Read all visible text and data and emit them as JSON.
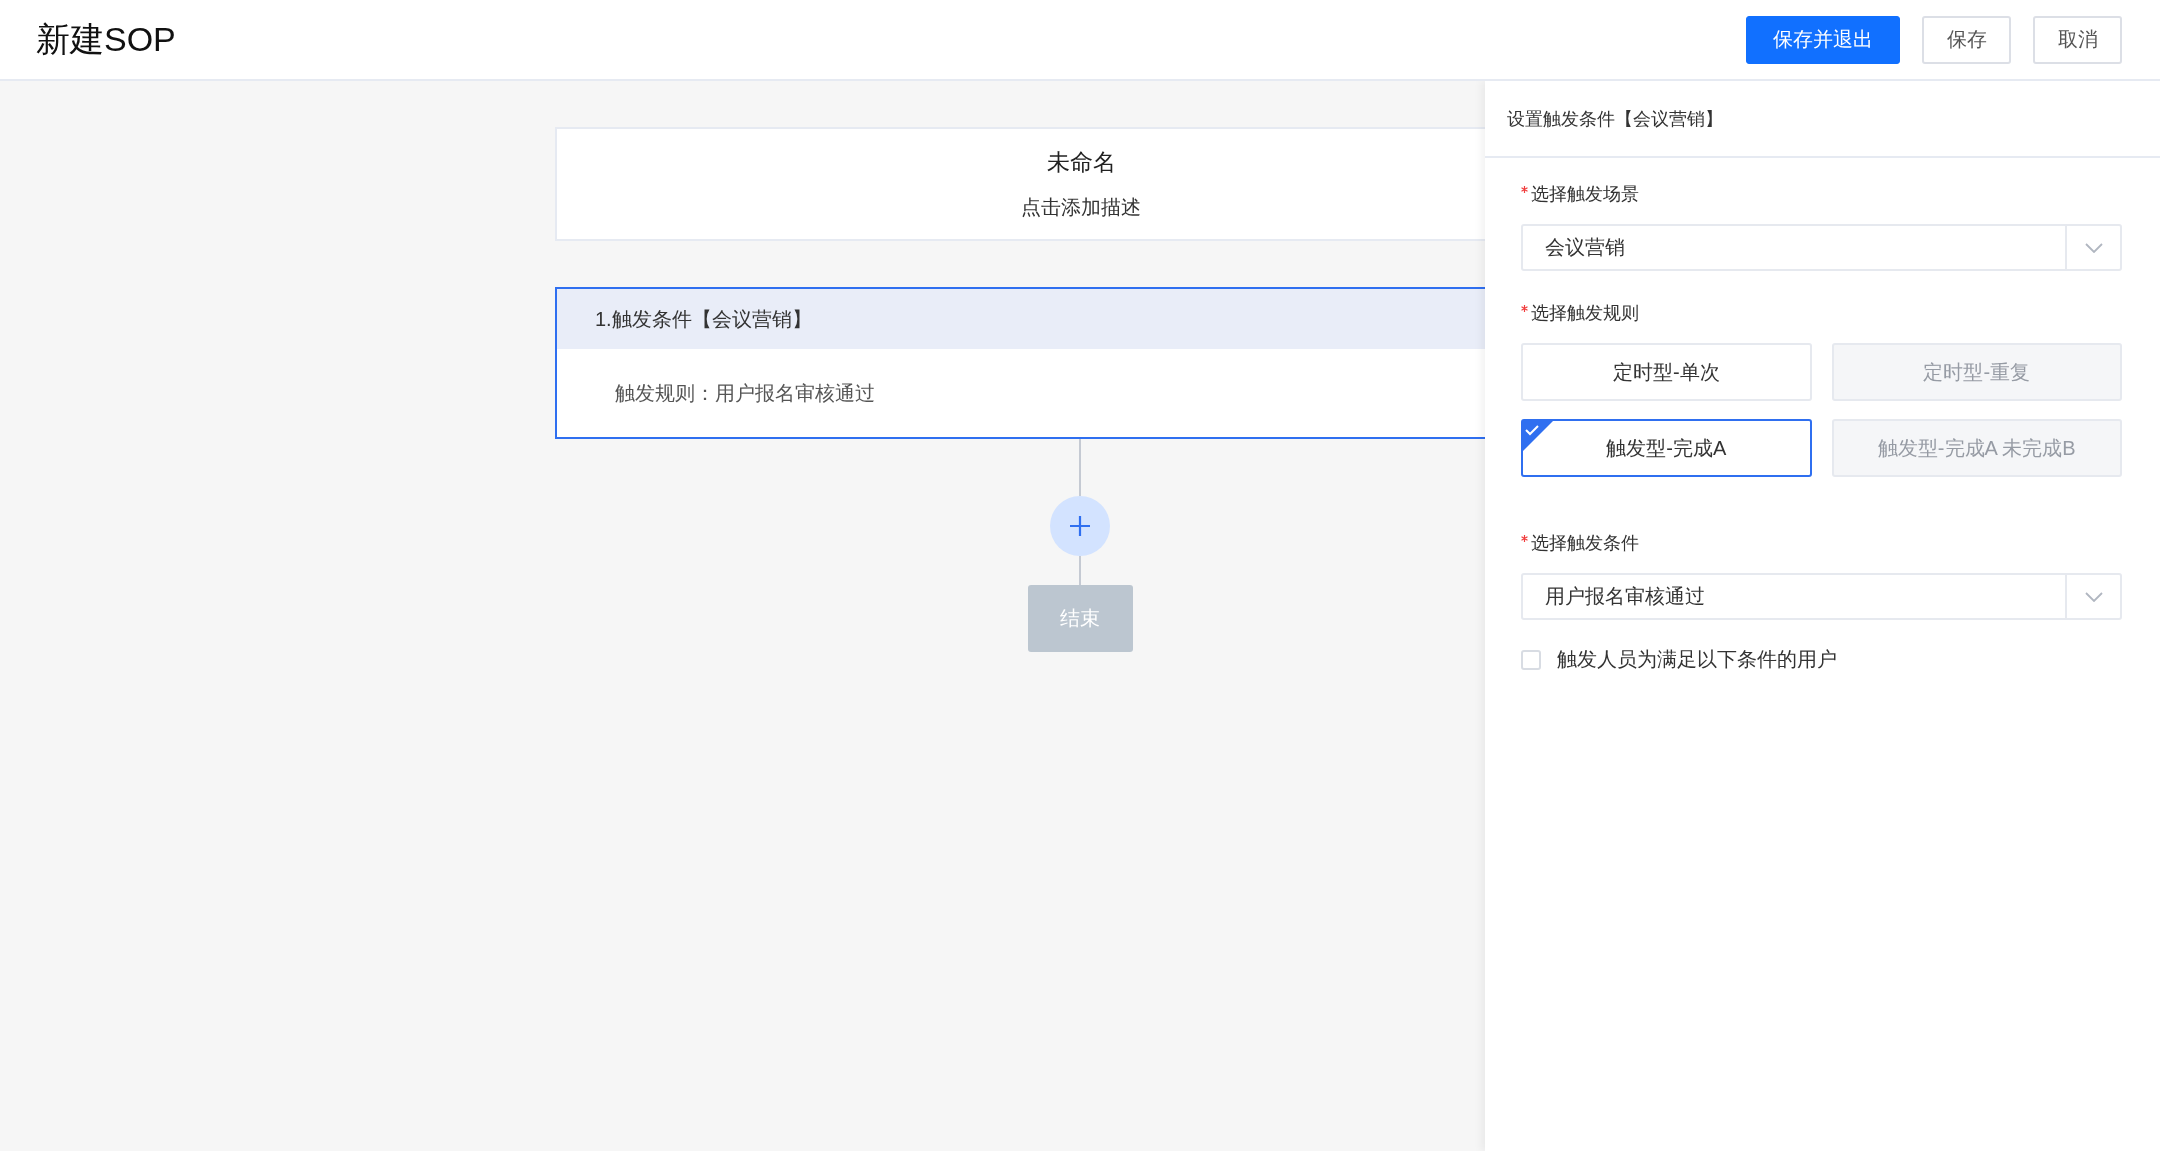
{
  "header": {
    "title": "新建SOP",
    "buttons": [
      {
        "label": "保存并退出",
        "kind": "primary"
      },
      {
        "label": "保存",
        "kind": "default"
      },
      {
        "label": "取消",
        "kind": "default"
      }
    ]
  },
  "canvas": {
    "flow_title": "未命名",
    "flow_description": "点击添加描述",
    "steps": [
      {
        "title": "1.触发条件【会议营销】",
        "rule": "触发规则：用户报名审核通过",
        "selected": true
      }
    ],
    "end_label": "结束"
  },
  "panel": {
    "title": "设置触发条件【会议营销】",
    "fields": [
      {
        "kind": "select",
        "label": "选择触发场景",
        "required": true,
        "value": "会议营销"
      },
      {
        "kind": "options",
        "label": "选择触发规则",
        "required": true,
        "options": [
          {
            "label": "定时型-单次",
            "selected": false,
            "disabled": false
          },
          {
            "label": "定时型-重复",
            "selected": false,
            "disabled": true
          },
          {
            "label": "触发型-完成A",
            "selected": true,
            "disabled": false
          },
          {
            "label": "触发型-完成A 未完成B",
            "selected": false,
            "disabled": true
          }
        ]
      },
      {
        "kind": "select",
        "label": "选择触发条件",
        "required": true,
        "value": "用户报名审核通过"
      },
      {
        "kind": "checkbox",
        "label": "触发人员为满足以下条件的用户",
        "checked": false
      }
    ]
  }
}
